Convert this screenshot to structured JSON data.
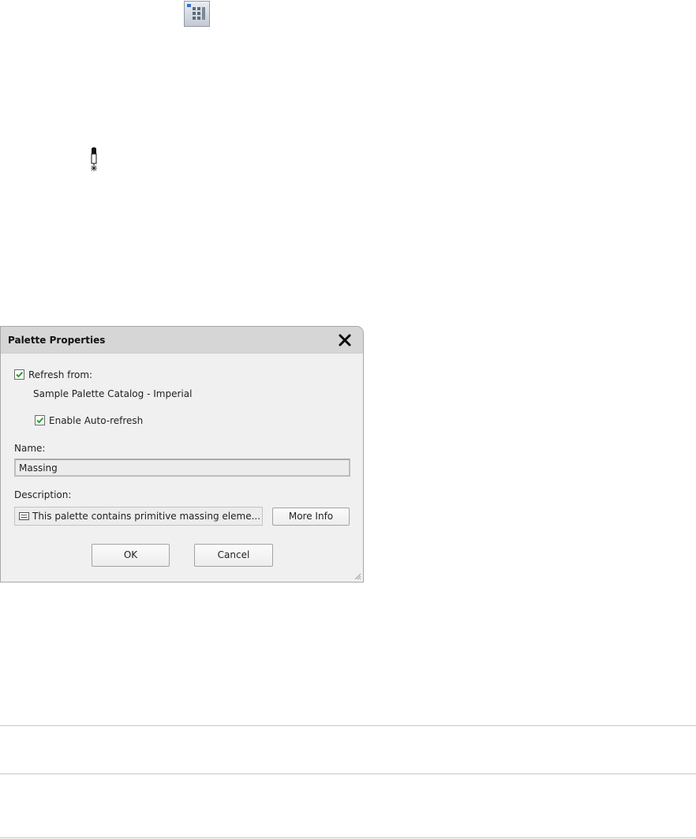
{
  "dialog": {
    "title": "Palette Properties",
    "refresh_from": {
      "label": "Refresh from:",
      "checked": true,
      "source": "Sample Palette Catalog - Imperial"
    },
    "auto_refresh": {
      "label": "Enable Auto-refresh",
      "checked": true
    },
    "name": {
      "label": "Name:",
      "value": "Massing"
    },
    "description": {
      "label": "Description:",
      "value": "This palette contains primitive massing eleme...",
      "more_info_label": "More Info"
    },
    "ok_label": "OK",
    "cancel_label": "Cancel"
  },
  "icons": {
    "palette_tool": "palette-tool-icon",
    "pin": "pin-icon",
    "close": "close-icon",
    "checkmark": "checkmark-icon",
    "description_note": "note-icon",
    "resize_grip": "resize-grip-icon"
  },
  "colors": {
    "checkmark": "#2e9d2e",
    "titlebar": "#d6d6d6",
    "dialog_bg": "#f0f0f0"
  }
}
